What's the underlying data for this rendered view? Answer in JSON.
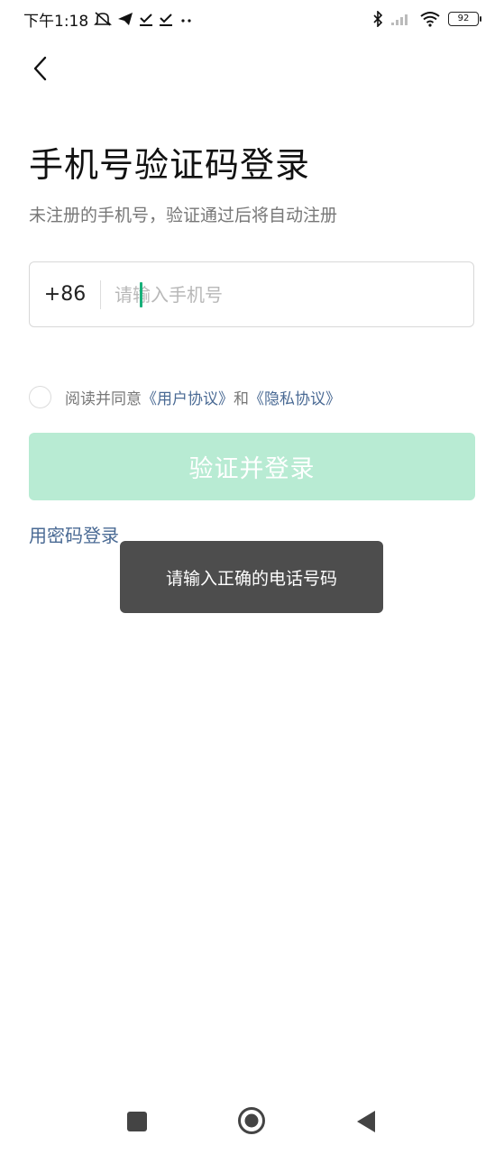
{
  "status_bar": {
    "time": "下午1:18",
    "battery": "92",
    "icons": [
      "mute-icon",
      "telegram-icon",
      "download-done-icon",
      "download-done-icon",
      "more-dots-icon",
      "bluetooth-icon",
      "signal-icon",
      "wifi-icon",
      "battery-icon"
    ]
  },
  "header": {
    "back_icon": "chevron-left-icon"
  },
  "main": {
    "title": "手机号验证码登录",
    "subtitle": "未注册的手机号，验证通过后将自动注册",
    "country_code": "+86",
    "phone_placeholder": "请输入手机号",
    "phone_value": "",
    "agree_prefix": "阅读并同意",
    "user_agreement": "《用户协议》",
    "agree_and": "和",
    "privacy_agreement": "《隐私协议》",
    "login_button": "验证并登录",
    "password_login": "用密码登录"
  },
  "toast": {
    "message": "请输入正确的电话号码"
  },
  "nav_bar": {
    "icons": [
      "recents-square-icon",
      "home-circle-icon",
      "back-triangle-icon"
    ]
  },
  "colors": {
    "accent": "#18b07a",
    "button_disabled": "#b8ebd3",
    "link": "#4a6a94",
    "toast_bg": "#4d4d4d"
  }
}
